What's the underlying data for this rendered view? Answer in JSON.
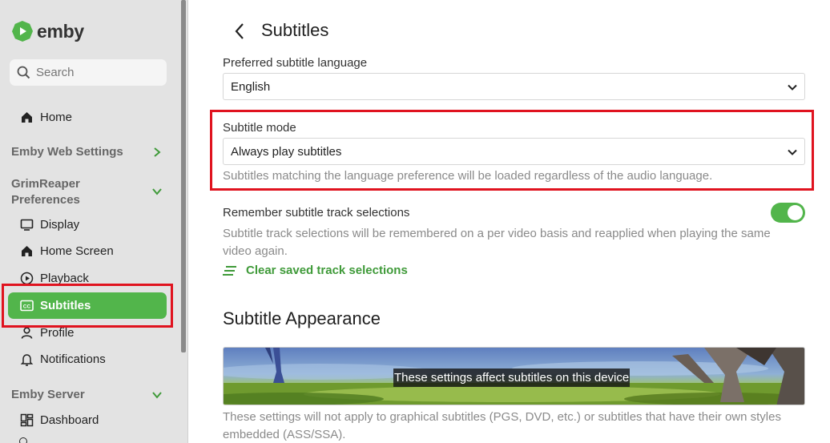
{
  "brand": {
    "name": "emby",
    "accent": "#52b54b"
  },
  "search": {
    "placeholder": "Search"
  },
  "sidebar": {
    "home": "Home",
    "section_web": "Emby Web Settings",
    "section_user_line1": "GrimReaper",
    "section_user_line2": "Preferences",
    "items": [
      {
        "label": "Display",
        "icon": "monitor-icon"
      },
      {
        "label": "Home Screen",
        "icon": "home-icon"
      },
      {
        "label": "Playback",
        "icon": "play-circle-icon"
      },
      {
        "label": "Subtitles",
        "icon": "closed-caption-icon",
        "active": true
      },
      {
        "label": "Profile",
        "icon": "person-icon"
      },
      {
        "label": "Notifications",
        "icon": "bell-icon"
      }
    ],
    "section_server": "Emby Server",
    "server_items": [
      {
        "label": "Dashboard",
        "icon": "dashboard-icon"
      }
    ]
  },
  "page": {
    "title": "Subtitles",
    "preferred_language": {
      "label": "Preferred subtitle language",
      "value": "English"
    },
    "subtitle_mode": {
      "label": "Subtitle mode",
      "value": "Always play subtitles",
      "helper": "Subtitles matching the language preference will be loaded regardless of the audio language."
    },
    "remember": {
      "label": "Remember subtitle track selections",
      "helper": "Subtitle track selections will be remembered on a per video basis and reapplied when playing the same video again.",
      "enabled": true
    },
    "clear_button": "Clear saved track selections",
    "appearance_title": "Subtitle Appearance",
    "preview_caption": "These settings affect subtitles on this device",
    "appearance_note": "These settings will not apply to graphical subtitles (PGS, DVD, etc.) or subtitles that have their own styles embedded (ASS/SSA)."
  },
  "highlight_color": "#e0131f"
}
